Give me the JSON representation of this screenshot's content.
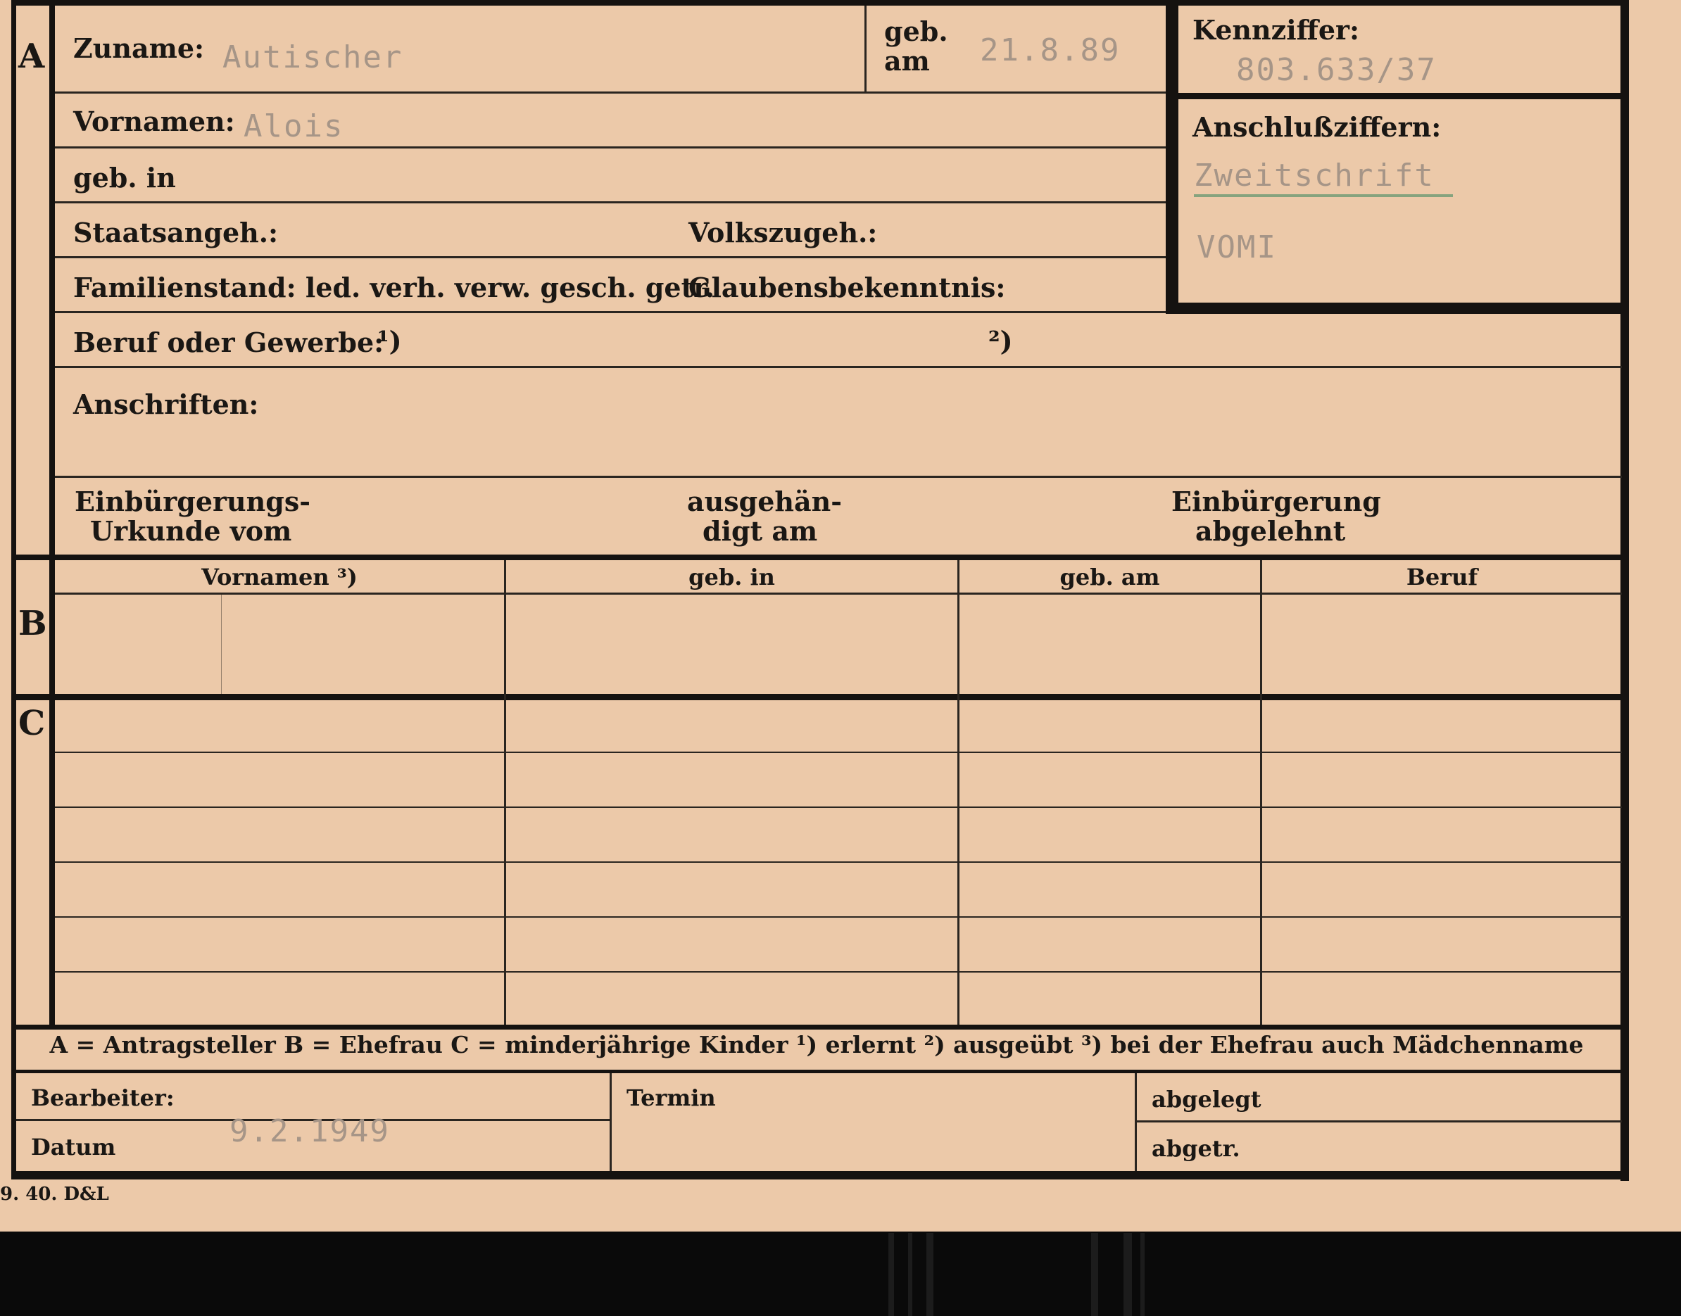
{
  "sections": {
    "a": "A",
    "b": "B",
    "c": "C"
  },
  "part_a": {
    "surname_label": "Zuname:",
    "surname_value": "Autischer",
    "birth_date_label_1": "geb.",
    "birth_date_label_2": "am",
    "birth_date_value": "21.8.89",
    "given_names_label": "Vornamen:",
    "given_names_value": "Alois",
    "birthplace_label": "geb. in",
    "citizenship_label": "Staatsangeh.:",
    "ethnicity_label": "Volkszugeh.:",
    "marital_label": "Familienstand: led. verh. verw. gesch. getr.",
    "religion_label": "Glaubensbekenntnis:",
    "profession_label": "Beruf oder Gewerbe:",
    "profession_note_1": "¹)",
    "profession_note_2": "²)",
    "addresses_label": "Anschriften:",
    "naturalization_doc_1": "Einbürgerungs-",
    "naturalization_doc_2": "Urkunde vom",
    "handed_over_1": "ausgehän-",
    "handed_over_2": "digt am",
    "naturalization_denied_1": "Einbürgerung",
    "naturalization_denied_2": "abgelehnt"
  },
  "side_panel": {
    "id_label": "Kennziffer:",
    "id_value": "803.633/37",
    "linked_label": "Anschlußziffern:",
    "copy_value": "Zweitschrift",
    "agency_value": "VOMI"
  },
  "table": {
    "headers": [
      "Vornamen ³)",
      "geb. in",
      "geb. am",
      "Beruf"
    ]
  },
  "legend": "A = Antragsteller   B = Ehefrau   C = minderjährige Kinder   ¹) erlernt   ²) ausgeübt   ³) bei der Ehefrau auch Mädchenname",
  "bottom": {
    "clerk_label": "Bearbeiter:",
    "date_label": "Datum",
    "date_value": "9.2.1949",
    "deadline_label": "Termin",
    "filed_label": "abgelegt",
    "removed_label": "abgetr."
  },
  "footer": "9. 40. D&L"
}
